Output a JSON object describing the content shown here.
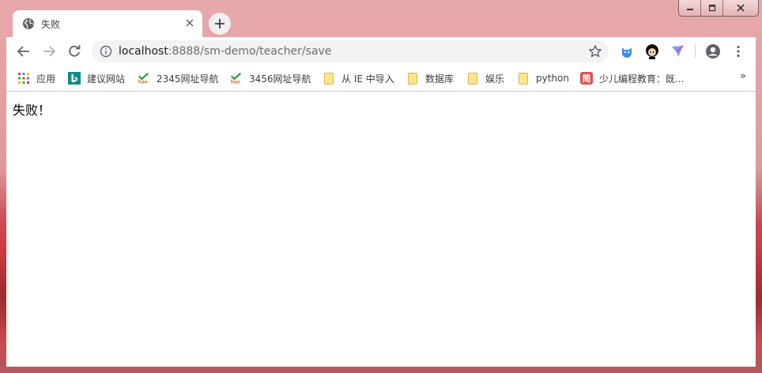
{
  "window": {
    "controls": [
      "minimize",
      "maximize",
      "close"
    ]
  },
  "tab": {
    "title": "失败",
    "favicon": "globe-icon"
  },
  "toolbar": {
    "url_host": "localhost",
    "url_rest": ":8888/sm-demo/teacher/save",
    "extensions": [
      "bird-extension-icon",
      "avatar-extension-icon",
      "send-extension-icon"
    ]
  },
  "bookmarks": [
    {
      "label": "应用",
      "icon": "apps-grid-icon"
    },
    {
      "label": "建议网站",
      "icon": "bing-icon"
    },
    {
      "label": "2345网址导航",
      "icon": "hao-icon"
    },
    {
      "label": "3456网址导航",
      "icon": "hao-icon"
    },
    {
      "label": "从 IE 中导入",
      "icon": "folder-icon"
    },
    {
      "label": "数据库",
      "icon": "folder-icon"
    },
    {
      "label": "娱乐",
      "icon": "folder-icon"
    },
    {
      "label": "python",
      "icon": "folder-icon"
    },
    {
      "label": "少儿编程教育：既...",
      "icon": "jian-icon",
      "icon_text": "简"
    }
  ],
  "bookmarks_more": "»",
  "page": {
    "message": "失败！"
  },
  "colors": {
    "frame_top": "#e8a9ab",
    "accent_blue": "#1a73e8"
  }
}
